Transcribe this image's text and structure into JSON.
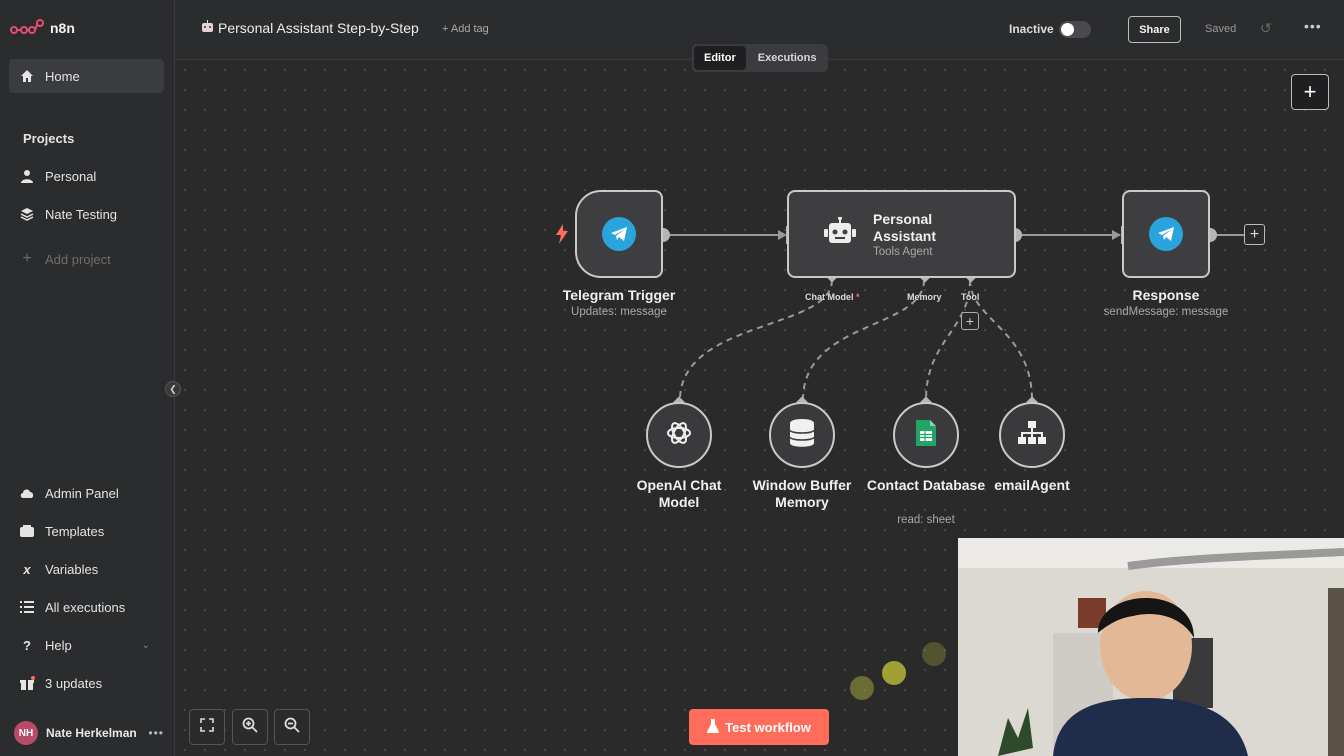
{
  "app": {
    "brand": "n8n"
  },
  "sidebar": {
    "home": "Home",
    "projects_heading": "Projects",
    "projects": [
      "Personal",
      "Nate Testing"
    ],
    "add_project": "Add project",
    "bottom": [
      "Admin Panel",
      "Templates",
      "Variables",
      "All executions",
      "Help",
      "3 updates"
    ],
    "user": {
      "initials": "NH",
      "name": "Nate Herkelman"
    }
  },
  "topbar": {
    "title": "Personal Assistant Step-by-Step",
    "add_tag": "+ Add tag",
    "status": "Inactive",
    "share": "Share",
    "saved": "Saved",
    "tabs": [
      "Editor",
      "Executions"
    ]
  },
  "workflow": {
    "nodes": {
      "trigger": {
        "title": "Telegram Trigger",
        "subtitle": "Updates: message"
      },
      "agent": {
        "title": "Personal Assistant",
        "subtitle": "Tools Agent"
      },
      "response": {
        "title": "Response",
        "subtitle": "sendMessage: message"
      }
    },
    "ports": {
      "chat_model": "Chat Model",
      "chat_model_required": "*",
      "memory": "Memory",
      "tool": "Tool"
    },
    "subnodes": {
      "openai": "OpenAI Chat Model",
      "memory": "Window Buffer Memory",
      "contacts": {
        "title": "Contact Database",
        "subtitle": "read: sheet"
      },
      "email": "emailAgent"
    }
  },
  "controls": {
    "test_workflow": "Test workflow"
  },
  "colors": {
    "accent": "#ff6d5a",
    "telegram": "#2aa4dc",
    "sheets": "#21a464"
  }
}
